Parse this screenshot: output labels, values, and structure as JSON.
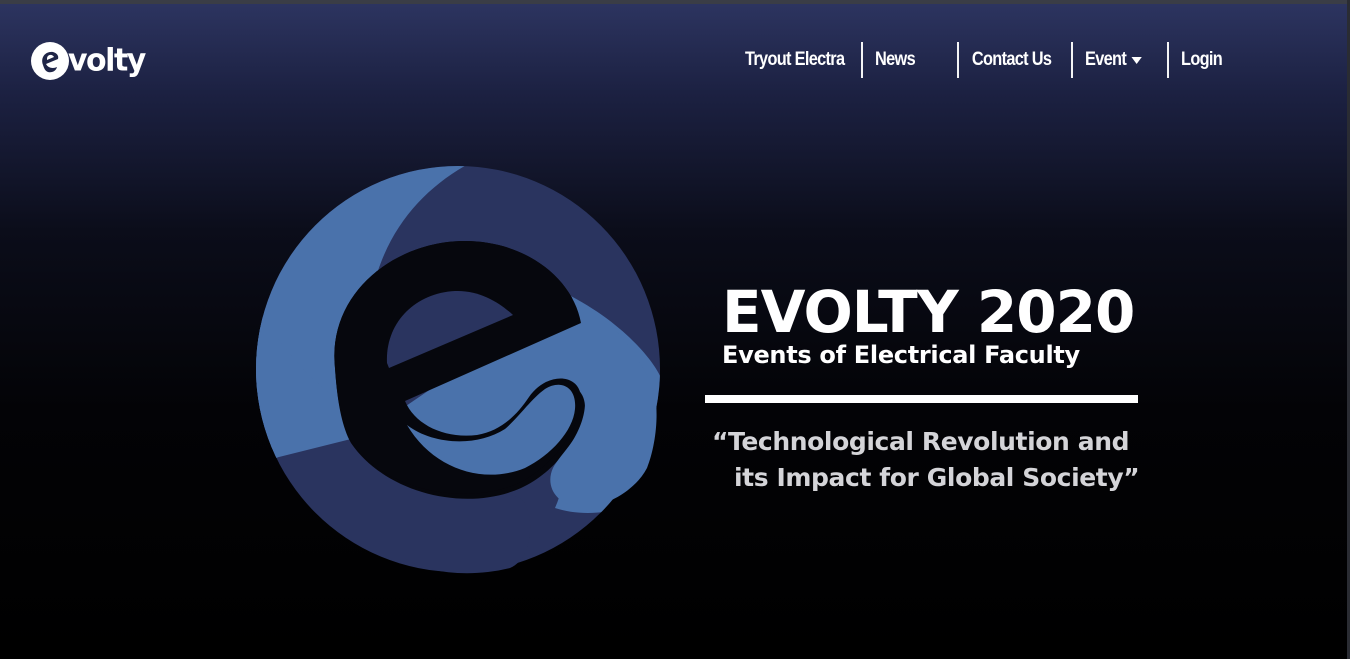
{
  "header": {
    "logo_text": "volty",
    "logo_icon": "evolty-e-logo-icon",
    "nav": [
      {
        "label": "Tryout Electra"
      },
      {
        "label": "News"
      },
      {
        "label": "Contact Us"
      },
      {
        "label": "Event",
        "has_dropdown": true
      },
      {
        "label": "Login"
      }
    ]
  },
  "hero": {
    "title": "EVOLTY 2020",
    "subtitle": "Events of Electrical Faculty",
    "quote_line1": "“Technological Revolution and",
    "quote_line2": "its Impact for Global Society”",
    "emblem_icon": "evolty-e-emblem-icon"
  },
  "colors": {
    "emblem_light": "#4a72ab",
    "emblem_dark": "#2a345f",
    "emblem_inner": "#06070d",
    "header_bg": "#2d3561",
    "quote": "#d4d4d8"
  }
}
